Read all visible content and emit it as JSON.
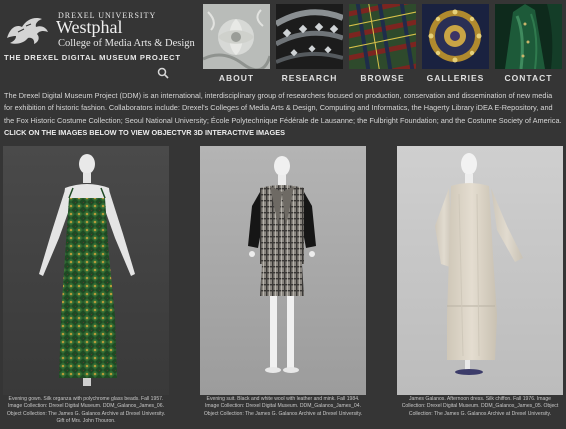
{
  "logo": {
    "university": "DREXEL UNIVERSITY",
    "name": "Westphal",
    "college": "College of Media Arts & Design"
  },
  "project_title": "THE DREXEL DIGITAL MUSEUM PROJECT",
  "nav": [
    {
      "label": "ABOUT",
      "icon": "embroidered-flower-thumbnail"
    },
    {
      "label": "RESEARCH",
      "icon": "beaded-panel-thumbnail"
    },
    {
      "label": "BROWSE",
      "icon": "plaid-fabric-thumbnail"
    },
    {
      "label": "GALLERIES",
      "icon": "jeweled-brooch-thumbnail"
    },
    {
      "label": "CONTACT",
      "icon": "green-gown-thumbnail"
    }
  ],
  "intro": {
    "text": "The Drexel Digital Museum Project (DDM) is an international, interdisciplinary group of researchers focused on production, conservation and dissemination of new media for exhibition of historic fashion. Collaborators include: Drexel's Colleges of Media Arts & Design, Computing and Informatics,  the  Hagerty Library iDEA E-Repository, and the Fox Historic Costume Collection; Seoul National University; École Polytechnique Fédérale de Lausanne; the Fulbright Foundation; and the Costume Society of America.",
    "cta": "CLICK ON THE IMAGES BELOW TO VIEW OBJECTVR 3D INTERACTIVE IMAGES"
  },
  "gallery": [
    {
      "caption_lines": [
        "Evening gown. Silk organza with polychrome glass beads. Fall 1957.",
        "Image Collection: Drexel Digital Museum. DDM_Galanos_James_06.",
        "Object Collection: The James G. Galanos Archive at Drexel University.",
        "Gift of Mrs. John Thouron."
      ],
      "colors": {
        "background": "#3e3e3e",
        "garment": "#1f4a24",
        "accent": "#b89a3a"
      }
    },
    {
      "caption_lines": [
        "Evening suit. Black and white wool with leather and mink. Fall 1984.",
        "Image Collection: Drexel Digital Museum. DDM_Galanos_James_04.",
        "Object Collection: The James G. Galanos Archive at Drexel University."
      ],
      "colors": {
        "background": "#a9a9a9",
        "garment": "#7d7a74",
        "accent": "#161616"
      }
    },
    {
      "caption_lines": [
        "James Galanos. Afternoon dress. Silk chiffon. Fall 1976. Image",
        "Collection: Drexel Digital Museum. DDM_Galanos_James_05. Object",
        "Collection: The James G. Galanos Archive at Drexel University."
      ],
      "colors": {
        "background": "#c6c6c6",
        "garment": "#ddd6c8",
        "accent": "#b9b2a4"
      }
    }
  ]
}
